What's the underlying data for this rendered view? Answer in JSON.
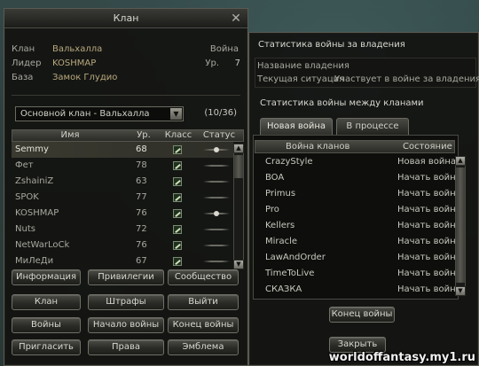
{
  "clan_window": {
    "title": "Клан",
    "close_glyph": "✕",
    "info": {
      "clan_label": "Клан",
      "clan_value": "Вальхалла",
      "leader_label": "Лидер",
      "leader_value": "KOSHMAP",
      "base_label": "База",
      "base_value": "Замок Глудио",
      "war_label": "Война",
      "level_label": "Ур.",
      "level_value": "7"
    },
    "subclan_select": {
      "value": "Основной клан - Вальхалла",
      "arrow": "▼"
    },
    "member_count": "(10/36)",
    "table": {
      "headers": {
        "name": "Имя",
        "level": "Ур.",
        "class": "Класс",
        "status": "Статус"
      },
      "rows": [
        {
          "name": "Semmy",
          "level": "68",
          "online": true,
          "selected": true
        },
        {
          "name": "Фет",
          "level": "78",
          "online": false
        },
        {
          "name": "ZshainiZ",
          "level": "63",
          "online": false
        },
        {
          "name": "SPOK",
          "level": "77",
          "online": false
        },
        {
          "name": "KOSHMAP",
          "level": "76",
          "online": true
        },
        {
          "name": "Nuts",
          "level": "72",
          "online": false
        },
        {
          "name": "NetWarLoCk",
          "level": "76",
          "online": false
        },
        {
          "name": "МиЛеДи",
          "level": "67",
          "online": false
        }
      ]
    },
    "buttons": {
      "info": "Информация",
      "privileges": "Привилегии",
      "community": "Сообщество",
      "clan": "Клан",
      "penalties": "Штрафы",
      "leave": "Выйти",
      "wars": "Войны",
      "start_war": "Начало войны",
      "end_war": "Конец войны",
      "invite": "Пригласить",
      "rights": "Права",
      "emblem": "Эмблема"
    }
  },
  "war_window": {
    "title": "Статистика войны за владения",
    "territory": {
      "name_label": "Название владения",
      "situation_label": "Текущая ситуация",
      "situation_value": "Участвует в войне за владения"
    },
    "between_clans_title": "Статистика войны между кланами",
    "tabs": {
      "new_war": "Новая война",
      "in_progress": "В процессе"
    },
    "table": {
      "headers": {
        "clan_war": "Война кланов",
        "state": "Состояние"
      },
      "rows": [
        {
          "clan": "CrazyStyle",
          "state": "Новая война"
        },
        {
          "clan": "BOA",
          "state": "Начать войну"
        },
        {
          "clan": "Primus",
          "state": "Начать войну"
        },
        {
          "clan": "Pro",
          "state": "Начать войну"
        },
        {
          "clan": "Kellers",
          "state": "Начать войну"
        },
        {
          "clan": "Miracle",
          "state": "Начать войну"
        },
        {
          "clan": "LawAndOrder",
          "state": "Начать войну"
        },
        {
          "clan": "TimeToLive",
          "state": "Начать войну"
        },
        {
          "clan": "СКАЗКА",
          "state": "Начать войну"
        }
      ]
    },
    "buttons": {
      "end_war": "Конец войны",
      "close": "Закрыть"
    }
  },
  "scroll_glyphs": {
    "up": "▲",
    "down": "▼"
  },
  "watermark": "worldoffantasy.my1.ru"
}
